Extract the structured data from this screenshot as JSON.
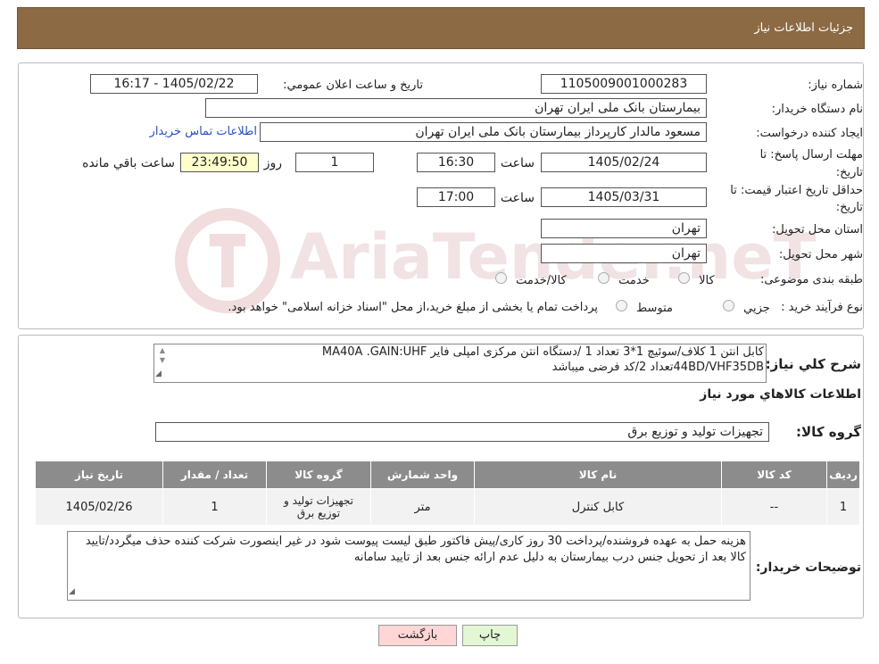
{
  "header": {
    "title": "جزئیات اطلاعات نیاز"
  },
  "watermark": {
    "text": "AriaTender.neT"
  },
  "form": {
    "need_number_label": "شماره نیاز:",
    "need_number": "1105009001000283",
    "announce_label": "تاریخ و ساعت اعلان عمومي:",
    "announce_value": "1405/02/22 - 16:17",
    "buyer_label": "نام دستگاه خریدار:",
    "buyer_value": "بیمارستان بانک ملی ایران تهران",
    "creator_label": "ایجاد کننده درخواست:",
    "creator_value": "مسعود مالدار کارپرداز بیمارستان بانک ملی ایران تهران",
    "contact_link": "اطلاعات تماس خریدار",
    "deadline_label_1": "مهلت ارسال پاسخ: تا",
    "deadline_label_2": "تاریخ:",
    "deadline_date": "1405/02/24",
    "time_label": "ساعت",
    "deadline_time": "16:30",
    "days_value": "1",
    "days_label": "روز و",
    "remaining_time": "23:49:50",
    "remaining_label": "ساعت باقي مانده",
    "validity_label_1": "حداقل تاریخ اعتبار قیمت: تا",
    "validity_label_2": "تاریخ:",
    "validity_date": "1405/03/31",
    "validity_time_label": "ساعت",
    "validity_time": "17:00",
    "province_label": "استان محل تحویل:",
    "province_value": "تهران",
    "city_label": "شهر محل تحویل:",
    "city_value": "تهران",
    "category_label": "طبقه بندی موضوعی:",
    "category_options": [
      "کالا",
      "خدمت",
      "کالا/خدمت"
    ],
    "process_label": "نوع فرآیند خرید :",
    "process_options": [
      "جزیي",
      "متوسط"
    ],
    "process_note": "پرداخت تمام یا بخشی از مبلغ خرید،از محل \"اسناد خزانه اسلامی\" خواهد بود."
  },
  "summary": {
    "label": "شرح کلي نیاز:",
    "line1": "کابل انتن 1 کلاف/سوئیچ 1*3 تعداد 1 /دستگاه انتن مرکزی امپلی فایر MA40A .GAIN:UHF",
    "line2": "44BD/VHF35DBتعداد 2/کد فرضی میباشد",
    "items_title": "اطلاعات کالاهاي مورد نیاز",
    "group_label": "گروه کالا:",
    "group_value": "تجهیزات تولید و توزیع برق"
  },
  "table": {
    "headers": [
      "ردیف",
      "کد کالا",
      "نام کالا",
      "واحد شمارش",
      "گروه کالا",
      "تعداد / مقدار",
      "تاریخ نیاز"
    ],
    "row": {
      "index": "1",
      "code": "--",
      "name": "کابل کنترل",
      "unit": "متر",
      "group": "تجهیزات تولید و توزیع برق",
      "qty": "1",
      "date": "1405/02/26"
    }
  },
  "notes": {
    "label": "توضیحات خریدار:",
    "text": "هزینه حمل به عهده فروشنده/پرداخت 30 روز کاری/پیش فاکتور طبق لیست پیوست شود در غیر اینصورت شرکت کننده حذف میگردد/تایید کالا بعد از تحویل جنس درب بیمارستان به دلیل عدم ارائه جنس بعد از تایید سامانه"
  },
  "buttons": {
    "print": "چاپ",
    "back": "بازگشت"
  },
  "colors": {
    "header": "#8b6a44",
    "back_button": "#ffd5d5",
    "print_button": "#e3f7d4",
    "table_header": "#8c8c8c",
    "remaining_bg": "#ffffcc"
  }
}
